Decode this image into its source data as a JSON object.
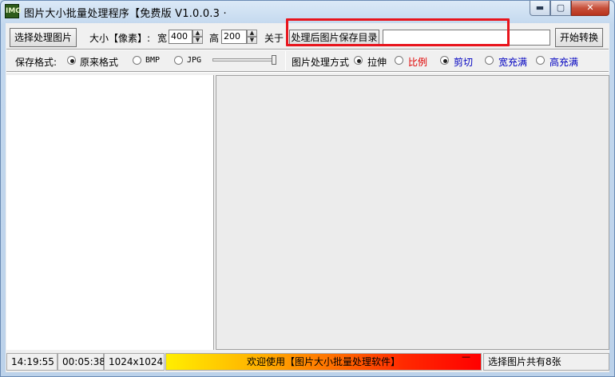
{
  "window": {
    "title": "图片大小批量处理程序【免费版 V1.0.0.3 ·",
    "icon_text": "IMG",
    "min_glyph": "▬",
    "max_glyph": "▢",
    "close_glyph": "✕"
  },
  "toolbar": {
    "select_images_button": "选择处理图片",
    "size_label": "大小【像素】:",
    "width_label": "宽",
    "width_value": "400",
    "height_label": "高",
    "height_value": "200",
    "about_label": "关于",
    "output_dir_button": "处理后图片保存目录",
    "output_dir_value": "",
    "start_button": "开始转换",
    "spin_up": "▲",
    "spin_down": "▼"
  },
  "options": {
    "save_format_label": "保存格式:",
    "formats": [
      {
        "label": "原来格式",
        "selected": true
      },
      {
        "label": "BMP",
        "selected": false
      },
      {
        "label": "JPG",
        "selected": false
      }
    ],
    "quality_slider_level": 1.0,
    "process_mode_label": "图片处理方式",
    "modes": [
      {
        "label": "拉伸",
        "selected": true,
        "color": "#000000"
      },
      {
        "label": "比例",
        "selected": false,
        "color": "#e00000"
      },
      {
        "label": "剪切",
        "selected": true,
        "color": "#0000c0"
      },
      {
        "label": "宽充满",
        "selected": false,
        "color": "#0000c0"
      },
      {
        "label": "高充满",
        "selected": false,
        "color": "#0000c0"
      }
    ]
  },
  "statusbar": {
    "clock": "14:19:55",
    "elapsed": "00:05:38",
    "resolution": "1024x1024",
    "welcome": "欢迎使用【图片大小批量处理软件】",
    "progress_marker": "—",
    "image_count": "选择图片共有8张"
  },
  "colors": {
    "highlight_box": "#e8141c"
  }
}
